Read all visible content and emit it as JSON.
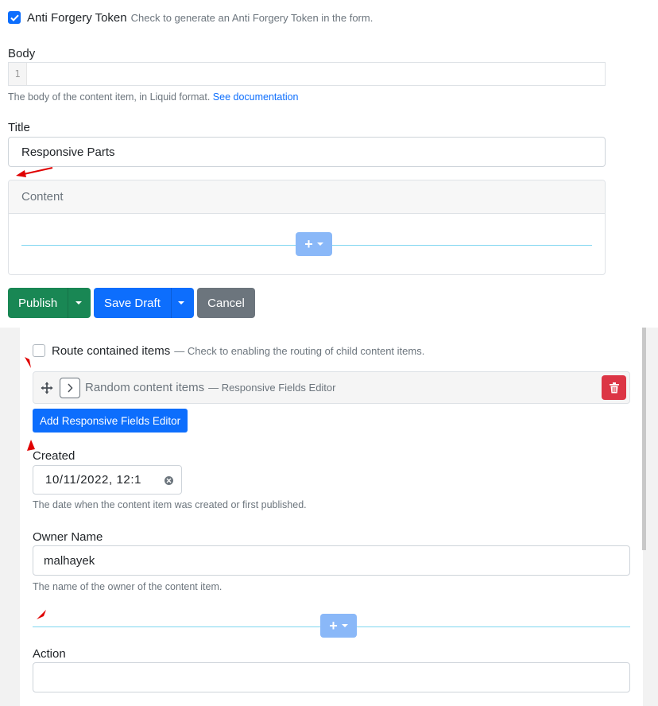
{
  "anti_forgery": {
    "label": "Anti Forgery Token",
    "hint": "Check to generate an Anti Forgery Token in the form.",
    "checked": true
  },
  "body_field": {
    "label": "Body",
    "line_number": "1",
    "hint": "The body of the content item, in Liquid format.",
    "hint_link": "See documentation"
  },
  "title_field": {
    "label": "Title",
    "value": "Responsive Parts"
  },
  "content_panel": {
    "header": "Content",
    "add_widget_icon": "plus-icon"
  },
  "actions": {
    "publish": "Publish",
    "save_draft": "Save Draft",
    "cancel": "Cancel"
  },
  "route_items": {
    "label": "Route contained items",
    "hint": "— Check to enabling the routing of child content items.",
    "checked": false
  },
  "contained_item": {
    "title": "Random content items",
    "subtitle": "— Responsive Fields Editor"
  },
  "add_button": "Add Responsive Fields Editor",
  "created_field": {
    "label": "Created",
    "value": "10/11/2022, 12:1",
    "hint": "The date when the content item was created or first published."
  },
  "owner_field": {
    "label": "Owner Name",
    "value": "malhayek",
    "hint": "The name of the owner of the content item."
  },
  "action_field": {
    "label": "Action",
    "value": ""
  },
  "colors": {
    "primary": "#0d6efd",
    "publish": "#198754",
    "cancel": "#6c757d",
    "danger": "#dc3545",
    "annotation_arrow": "#e00000"
  }
}
